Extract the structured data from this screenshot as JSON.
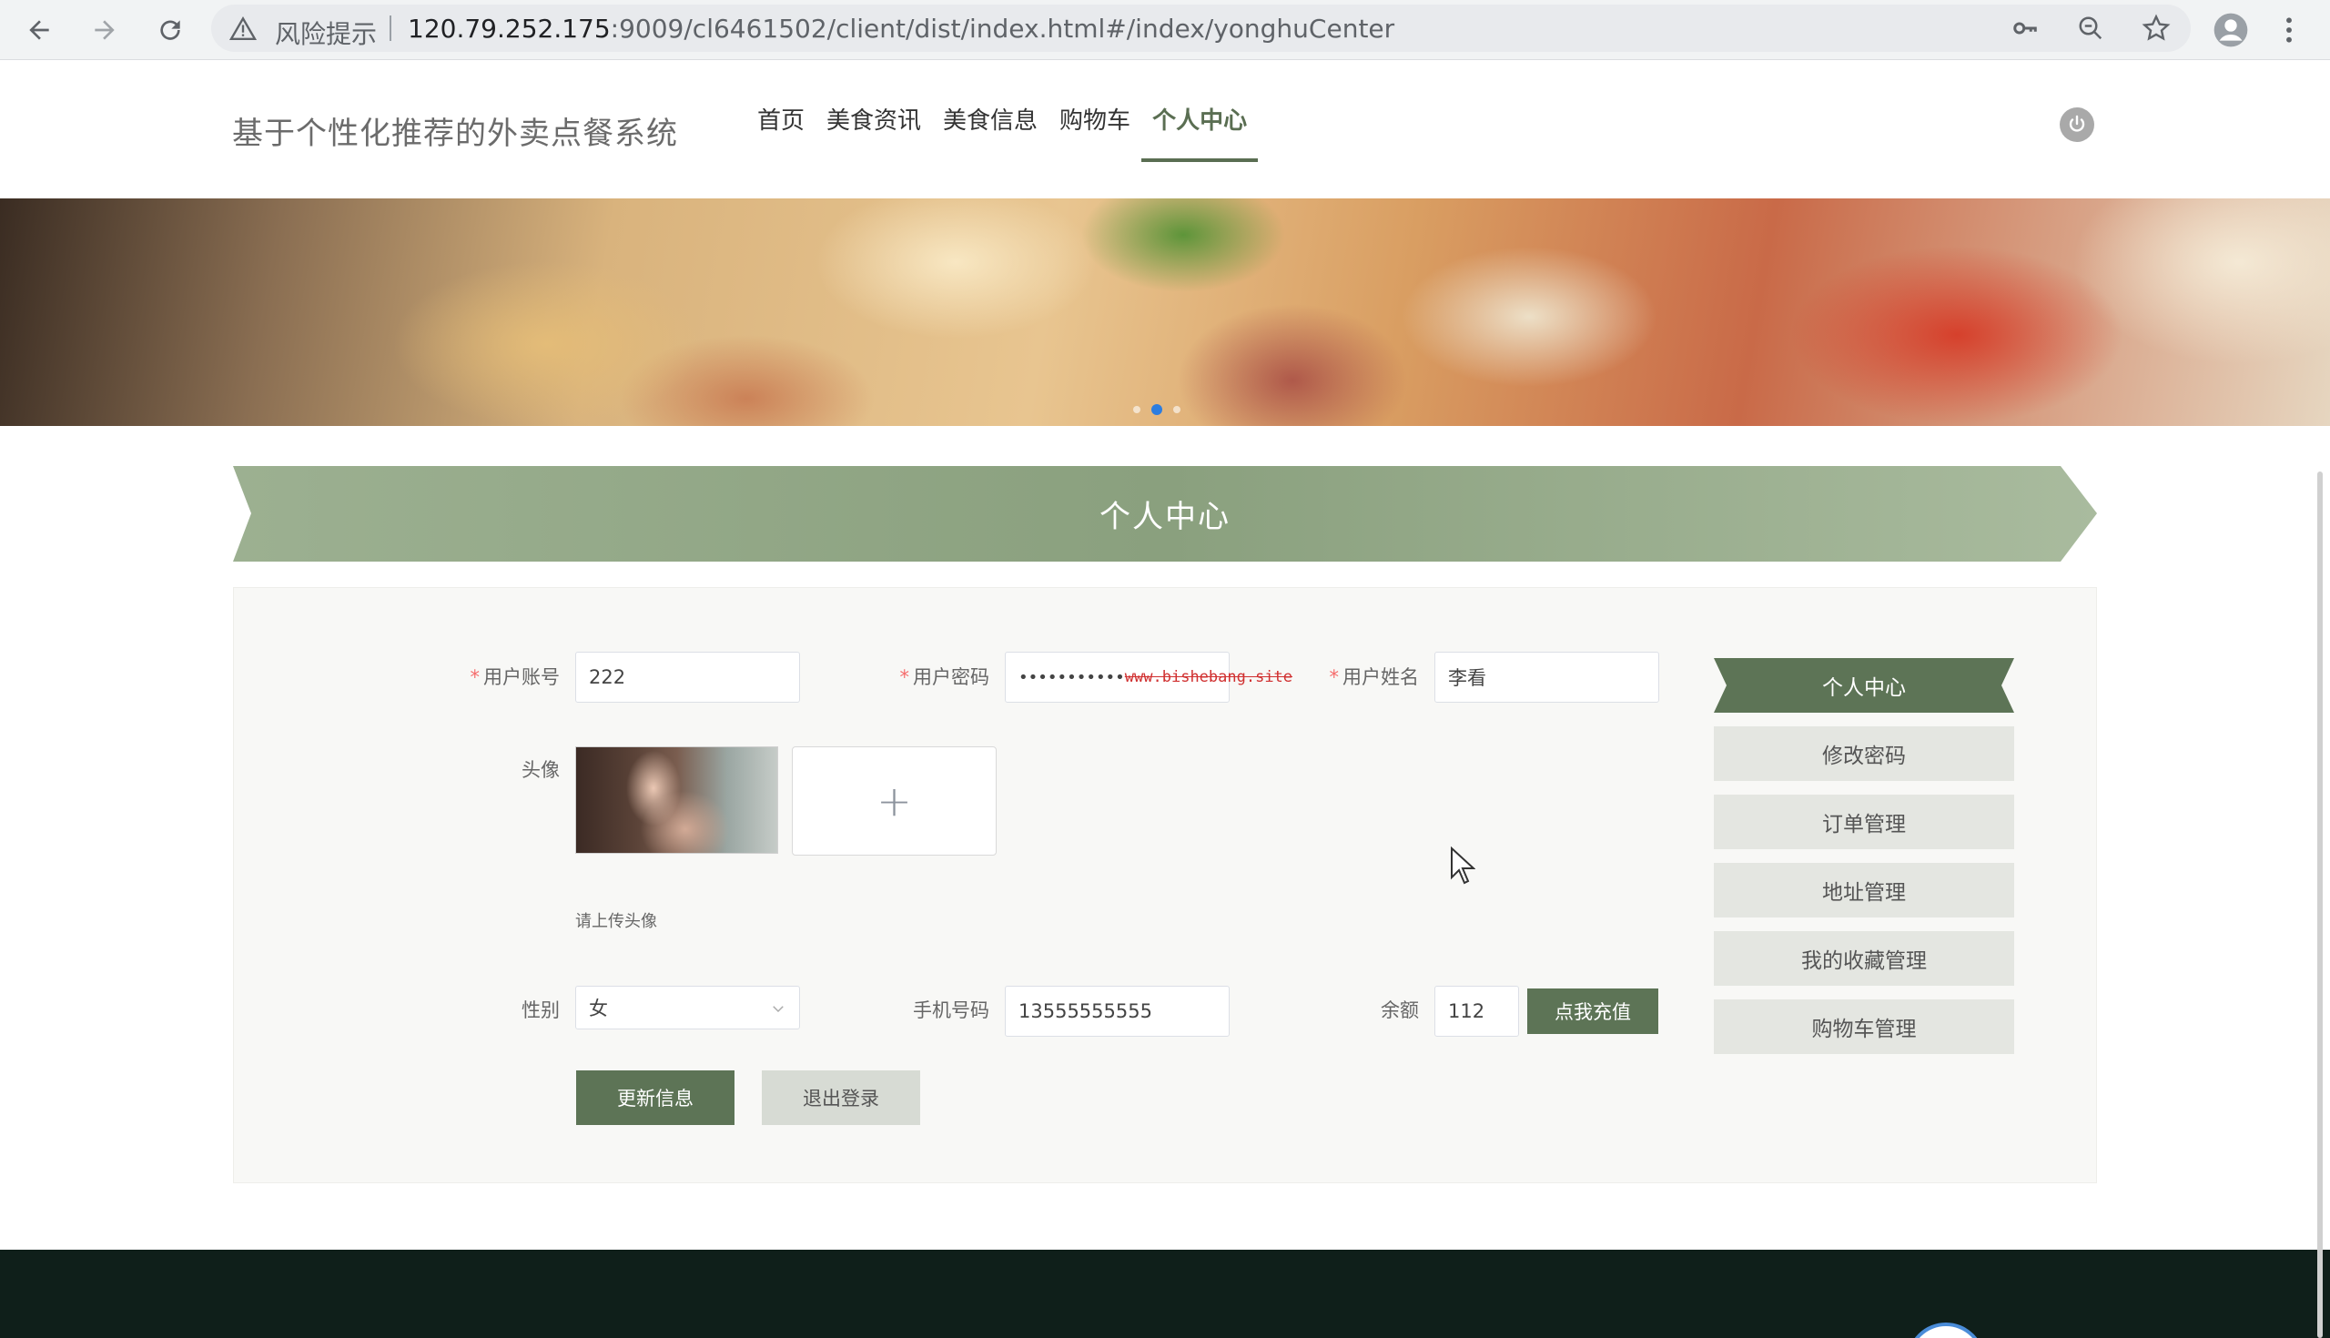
{
  "browser": {
    "warning_label": "风险提示",
    "url_host": "120.79.252.175",
    "url_rest": ":9009/cl6461502/client/dist/index.html#/index/yonghuCenter"
  },
  "site": {
    "title": "基于个性化推荐的外卖点餐系统",
    "nav": [
      "首页",
      "美食资讯",
      "美食信息",
      "购物车",
      "个人中心"
    ],
    "active_nav": "个人中心"
  },
  "section": {
    "title": "个人中心"
  },
  "form": {
    "account_label": "用户账号",
    "account_value": "222",
    "password_label": "用户密码",
    "password_value": "•••••••••••",
    "password_watermark": "www.bishebang.site",
    "name_label": "用户姓名",
    "name_value": "李看",
    "avatar_label": "头像",
    "upload_plus": "+",
    "upload_hint": "请上传头像",
    "gender_label": "性别",
    "gender_value": "女",
    "phone_label": "手机号码",
    "phone_value": "13555555555",
    "balance_label": "余额",
    "balance_value": "112",
    "recharge_button": "点我充值",
    "update_button": "更新信息",
    "logout_button": "退出登录"
  },
  "menu": [
    "个人中心",
    "修改密码",
    "订单管理",
    "地址管理",
    "我的收藏管理",
    "购物车管理"
  ],
  "colors": {
    "accent": "#5d7456",
    "ribbon": "#90a584",
    "footer": "#0f1f1a"
  }
}
